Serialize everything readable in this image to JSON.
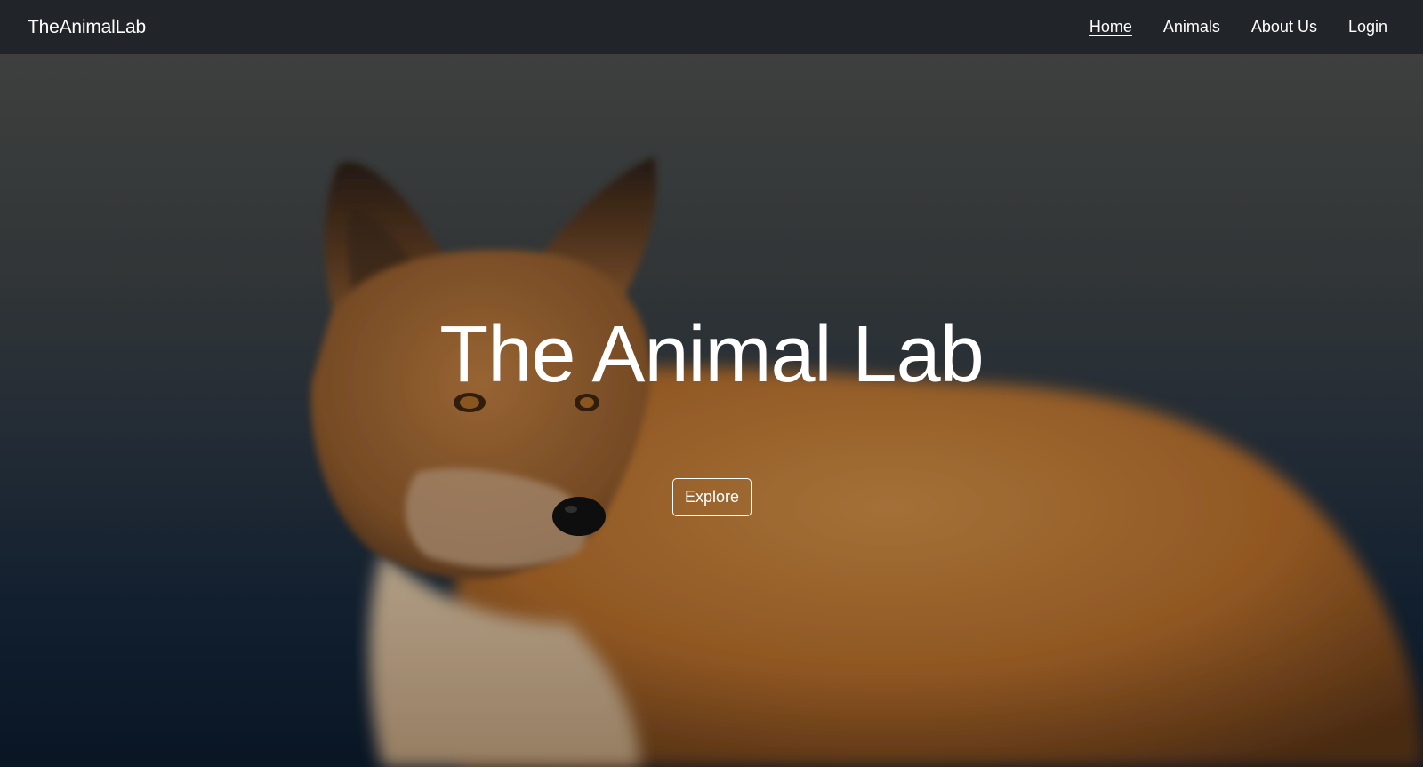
{
  "navbar": {
    "brand": "TheAnimalLab",
    "links": [
      {
        "label": "Home",
        "active": true
      },
      {
        "label": "Animals",
        "active": false
      },
      {
        "label": "About Us",
        "active": false
      },
      {
        "label": "Login",
        "active": false
      }
    ]
  },
  "hero": {
    "title": "The Animal Lab",
    "button_label": "Explore",
    "image": "red fox portrait"
  },
  "colors": {
    "navbar_bg": "#212529",
    "text": "#ffffff",
    "fox_fur": "#c9803a",
    "background_top": "#4c4e4c",
    "background_bottom": "#0c1b2c"
  }
}
